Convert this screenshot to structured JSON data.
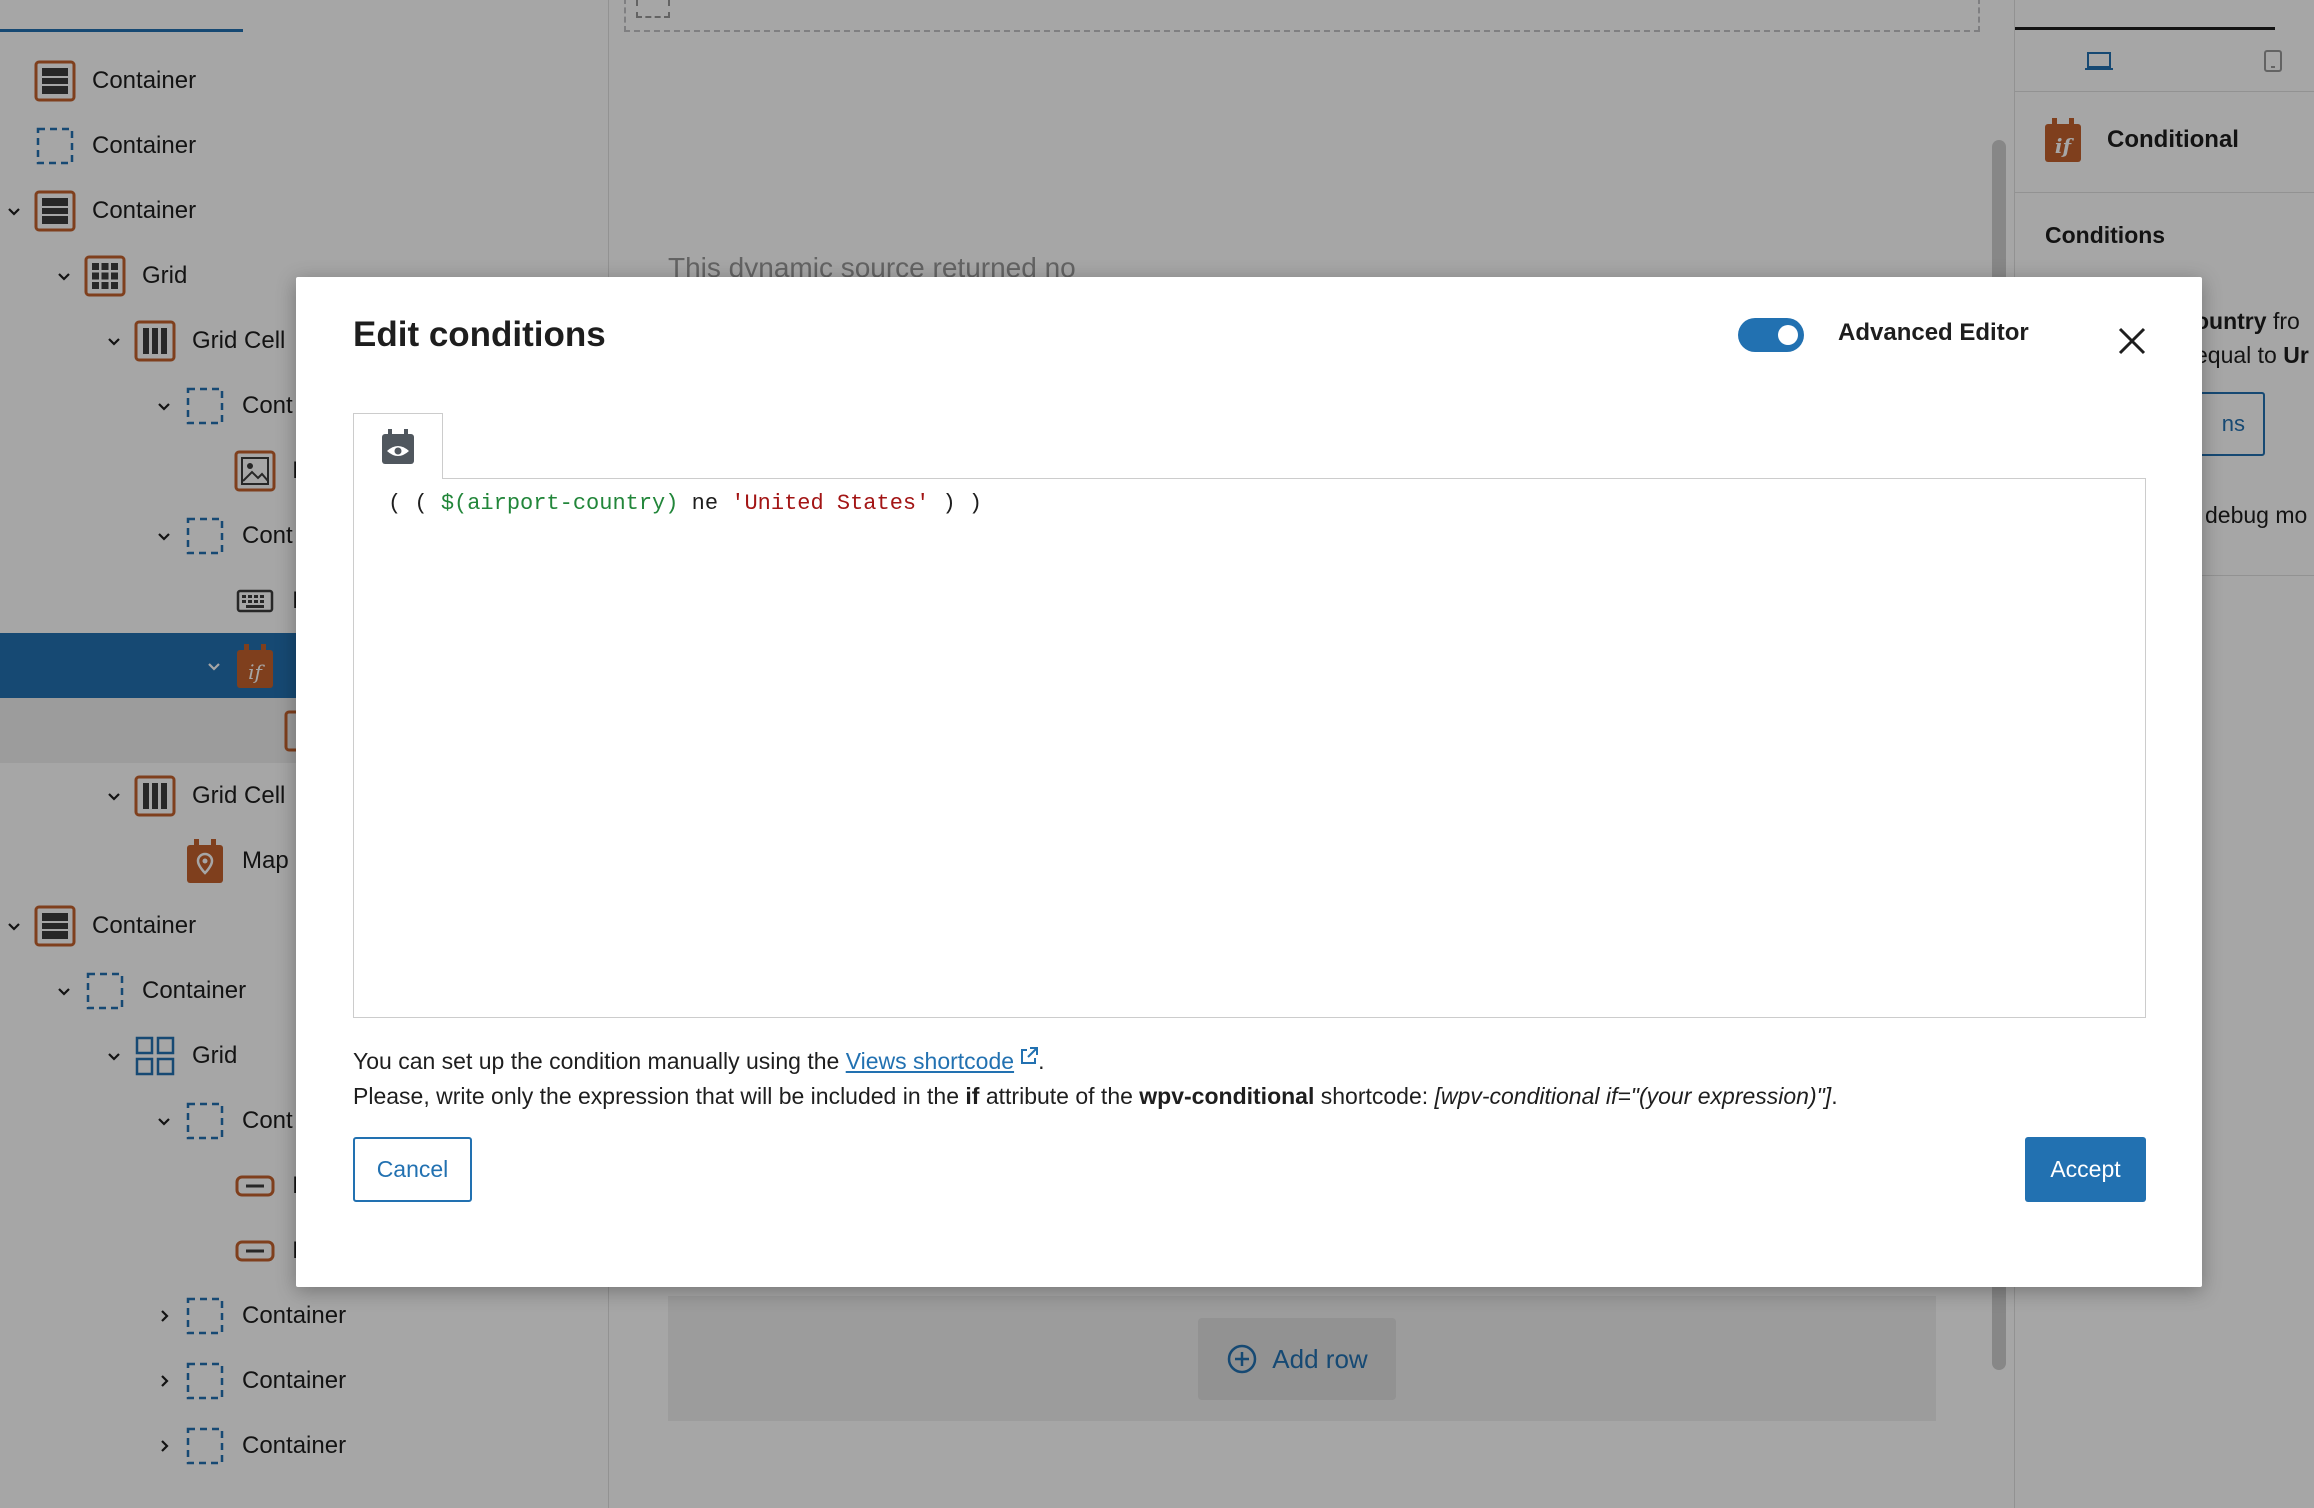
{
  "navigator": {
    "rows": [
      {
        "label": "Container",
        "icon": "container-stack-icon",
        "expanded": null
      },
      {
        "label": "Container",
        "icon": "container-dashed-icon",
        "expanded": null
      },
      {
        "label": "Container",
        "icon": "container-stack-icon",
        "expanded": true
      },
      {
        "label": "Grid",
        "icon": "grid-icon",
        "expanded": true
      },
      {
        "label": "Grid Cell",
        "icon": "grid-cell-icon",
        "expanded": true
      },
      {
        "label": "Cont",
        "icon": "container-dashed-icon",
        "expanded": true
      },
      {
        "label": "I",
        "icon": "image-icon",
        "expanded": null
      },
      {
        "label": "Cont",
        "icon": "container-dashed-icon",
        "expanded": true
      },
      {
        "label": "I",
        "icon": "keyboard-icon",
        "expanded": null
      },
      {
        "label": "",
        "icon": "conditional-icon",
        "expanded": true
      },
      {
        "label": "",
        "icon": "block-icon",
        "expanded": null
      },
      {
        "label": "Grid Cell",
        "icon": "grid-cell-icon",
        "expanded": true
      },
      {
        "label": "Map",
        "icon": "map-icon",
        "expanded": null
      },
      {
        "label": "Container",
        "icon": "container-stack-icon",
        "expanded": true
      },
      {
        "label": "Container",
        "icon": "container-dashed-icon",
        "expanded": true
      },
      {
        "label": "Grid",
        "icon": "grid-blue-icon",
        "expanded": true
      },
      {
        "label": "Cont",
        "icon": "container-dashed-icon",
        "expanded": true
      },
      {
        "label": "I",
        "icon": "button-icon",
        "expanded": null
      },
      {
        "label": "I",
        "icon": "button-icon",
        "expanded": null
      },
      {
        "label": "Container",
        "icon": "container-dashed-icon",
        "expanded": false
      },
      {
        "label": "Container",
        "icon": "container-dashed-icon",
        "expanded": false
      },
      {
        "label": "Container",
        "icon": "container-dashed-icon",
        "expanded": false
      }
    ]
  },
  "canvas": {
    "source_message": "This dynamic source returned no",
    "add_row_label": "Add row"
  },
  "sidebar": {
    "block_name": "Conditional",
    "conditions_title": "Conditions",
    "summary_line1_bold": "ountry",
    "summary_line1_rest": " fro",
    "summary_line2_start": "equal to ",
    "summary_line2_bold": "Ur",
    "edit_button_label": "ns",
    "debug_label": "debug mo"
  },
  "modal": {
    "title": "Edit conditions",
    "toggle_label": "Advanced Editor",
    "toggle_on": true,
    "code": {
      "prefix": "( ( ",
      "variable": "$(airport-country)",
      "operator": " ne ",
      "string": "'United States'",
      "suffix": " ) )"
    },
    "help_line1_prefix": "You can set up the condition manually using the ",
    "help_link": "Views shortcode",
    "help_line1_suffix": ".",
    "help_line2_a": "Please, write only the expression that will be included in the ",
    "help_line2_if": "if",
    "help_line2_b": " attribute of the ",
    "help_line2_shortcode": "wpv-conditional",
    "help_line2_c": " shortcode: ",
    "help_line2_example": "[wpv-conditional if=\"(your expression)\"]",
    "help_line2_d": ".",
    "cancel_label": "Cancel",
    "accept_label": "Accept"
  },
  "colors": {
    "accent": "#2271b1",
    "block_icon": "#c4622d",
    "code_variable": "#22863a",
    "code_string": "#a31515"
  }
}
